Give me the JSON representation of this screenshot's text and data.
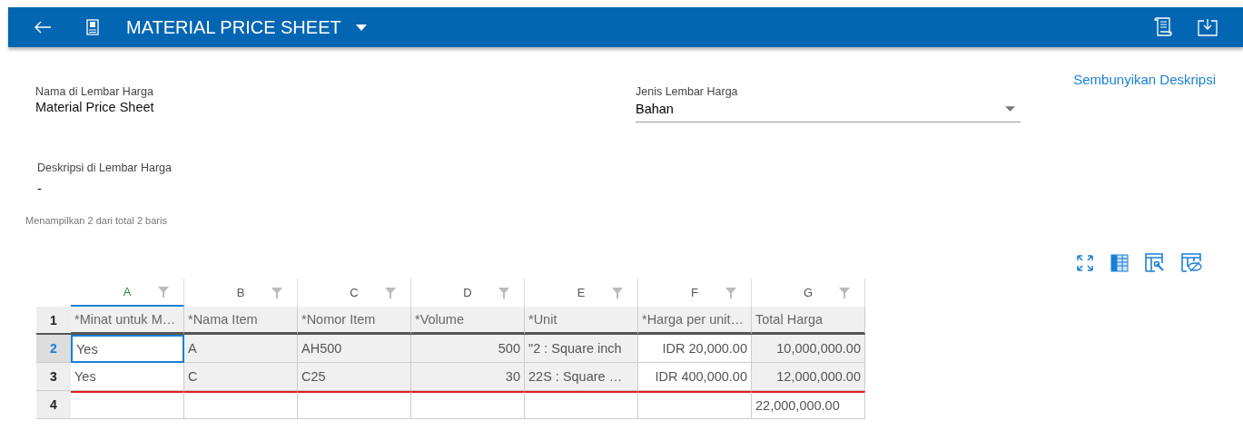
{
  "header": {
    "title": "MATERIAL PRICE SHEET"
  },
  "toggle_description": "Sembunyikan Deskripsi",
  "fields": [
    {
      "label": "Nama di Lembar Harga",
      "value": "Material Price Sheet",
      "kind": "text"
    },
    {
      "label": "Jenis Lembar Harga",
      "value": "Bahan",
      "kind": "dropdown"
    }
  ],
  "description": {
    "label": "Deskripsi di Lembar Harga",
    "value": "-"
  },
  "row_count": "Menampilkan 2 dari total 2 baris",
  "sheet": {
    "columns": [
      {
        "letter": "A",
        "selected": true,
        "editable": true
      },
      {
        "letter": "B",
        "selected": false,
        "editable": false
      },
      {
        "letter": "C",
        "selected": false,
        "editable": false
      },
      {
        "letter": "D",
        "selected": false,
        "editable": false
      },
      {
        "letter": "E",
        "selected": false,
        "editable": false
      },
      {
        "letter": "F",
        "selected": false,
        "editable": true
      },
      {
        "letter": "G",
        "selected": false,
        "editable": false
      }
    ],
    "rows": [
      {
        "number": "1",
        "selected": false,
        "kind": "header",
        "cells": [
          "*Minat untuk M…",
          "*Nama Item",
          "*Nomor Item",
          "*Volume",
          "*Unit",
          "*Harga per unit…",
          "Total Harga"
        ]
      },
      {
        "number": "2",
        "selected": true,
        "kind": "data",
        "cells": [
          "Yes",
          "A",
          "AH500",
          "500",
          "\"2 : Square inch",
          "IDR 20,000.00",
          "10,000,000.00"
        ]
      },
      {
        "number": "3",
        "selected": false,
        "kind": "data",
        "cells": [
          "Yes",
          "C",
          "C25",
          "30",
          "22S : Square …",
          "IDR 400,000.00",
          "12,000,000.00"
        ]
      },
      {
        "number": "4",
        "selected": false,
        "kind": "total",
        "cells": [
          "",
          "",
          "",
          "",
          "",
          "",
          "22,000,000.00"
        ]
      }
    ]
  }
}
